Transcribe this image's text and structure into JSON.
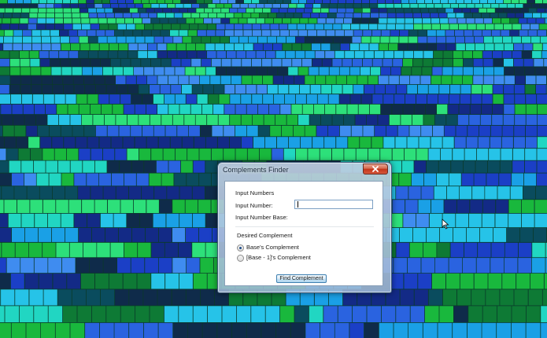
{
  "window": {
    "title": "Complements Finder",
    "close_icon": "close-icon"
  },
  "form": {
    "group_input_label": "Input Numbers",
    "input_number_label": "Input Number:",
    "input_number_value": "",
    "input_base_label": "Input Number Base:",
    "input_base_value": "",
    "group_complement_label": "Desired Complement",
    "radio_options": [
      {
        "label": "Base's Complement",
        "selected": true
      },
      {
        "label": "[Base - 1]'s Complement",
        "selected": false
      }
    ],
    "find_button_label": "Find Complement"
  },
  "colors": {
    "wallpaper": [
      "#1b3fc6",
      "#2a63e0",
      "#1aa0e6",
      "#26c3e8",
      "#2de07a",
      "#19b83d",
      "#0e7a35",
      "#0a4c5e",
      "#132a86",
      "#3f8cf0",
      "#21d6c2",
      "#0f2b4a"
    ],
    "titlebar_glass": "#b9cde5",
    "close_button": "#c2361a",
    "button_border": "#3c7fb1"
  }
}
